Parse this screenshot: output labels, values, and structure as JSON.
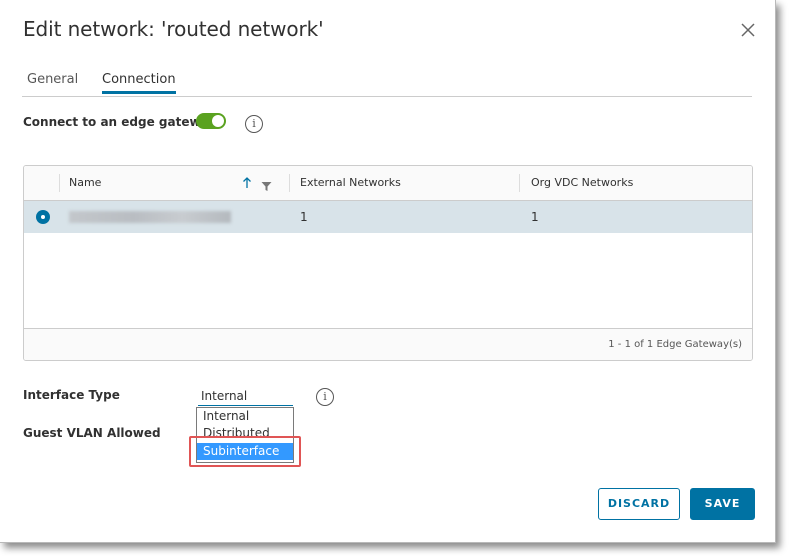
{
  "dialog": {
    "title": "Edit network: 'routed network'"
  },
  "tabs": [
    {
      "label": "General"
    },
    {
      "label": "Connection"
    }
  ],
  "edge_gateway": {
    "label": "Connect to an edge gateway",
    "toggle_on": true
  },
  "grid": {
    "columns": {
      "name": "Name",
      "external": "External Networks",
      "orgvdc": "Org VDC Networks"
    },
    "rows": [
      {
        "external": "1",
        "orgvdc": "1",
        "selected": true
      }
    ],
    "footer": "1 - 1 of 1 Edge Gateway(s)"
  },
  "interface_type": {
    "label": "Interface Type",
    "value": "Internal",
    "options": [
      "Internal",
      "Distributed",
      "Subinterface"
    ],
    "highlighted": "Subinterface"
  },
  "guest_vlan": {
    "label": "Guest VLAN Allowed"
  },
  "buttons": {
    "discard": "DISCARD",
    "save": "SAVE"
  },
  "colors": {
    "accent": "#0072a3",
    "toggle": "#5aa220",
    "selected_row": "#d8e3e9",
    "option_highlight": "#3399ff",
    "callout": "#e05555"
  },
  "icons": {
    "close": "close-icon",
    "info": "info-icon",
    "sort": "sort-arrow-up-icon",
    "filter": "filter-icon"
  }
}
